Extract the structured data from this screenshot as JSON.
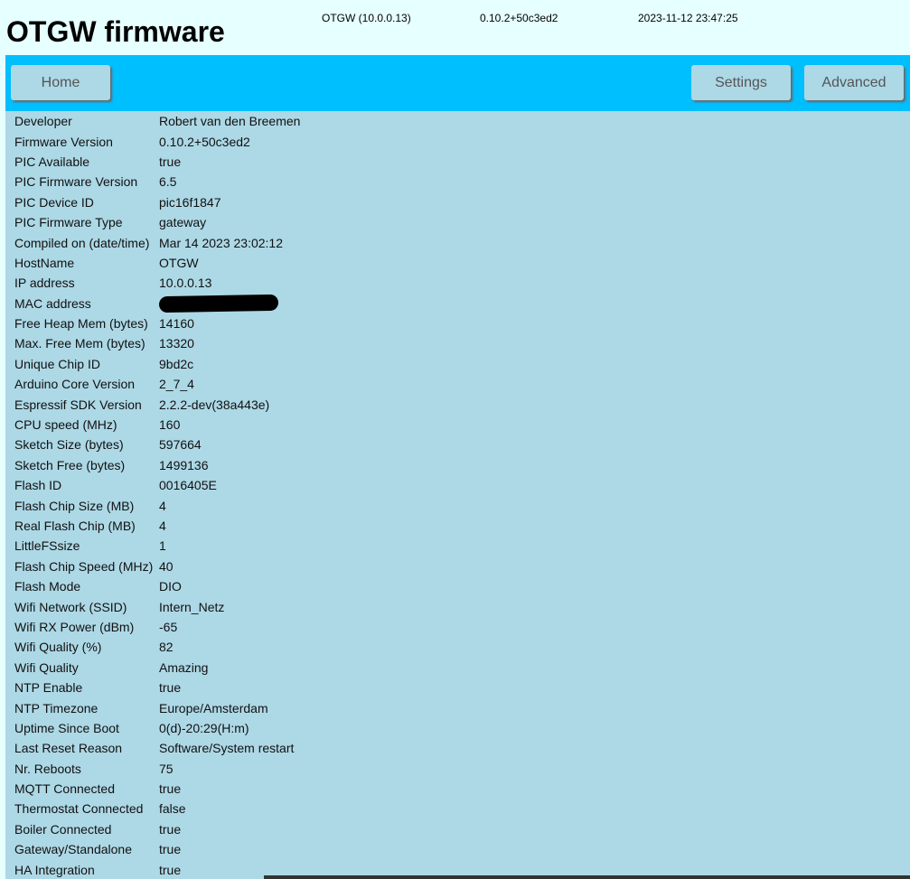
{
  "header": {
    "title": "OTGW firmware",
    "host_info": "OTGW (10.0.0.13)",
    "version": "0.10.2+50c3ed2",
    "datetime": "2023-11-12 23:47:25"
  },
  "nav": {
    "home": "Home",
    "settings": "Settings",
    "advanced": "Advanced"
  },
  "colors": {
    "header_bg": "#e6ffff",
    "navbar_bg": "#00bfff",
    "content_bg": "#add8e6",
    "button_bg": "#add8e6"
  },
  "info_rows": [
    {
      "label": "Developer",
      "value": "Robert van den Breemen"
    },
    {
      "label": "Firmware Version",
      "value": "0.10.2+50c3ed2"
    },
    {
      "label": "PIC Available",
      "value": "true"
    },
    {
      "label": "PIC Firmware Version",
      "value": "6.5"
    },
    {
      "label": "PIC Device ID",
      "value": "pic16f1847"
    },
    {
      "label": "PIC Firmware Type",
      "value": "gateway"
    },
    {
      "label": "Compiled on (date/time)",
      "value": "Mar 14 2023 23:02:12"
    },
    {
      "label": "HostName",
      "value": "OTGW"
    },
    {
      "label": "IP address",
      "value": "10.0.0.13"
    },
    {
      "label": "MAC address",
      "value": "",
      "redacted": true
    },
    {
      "label": "Free Heap Mem (bytes)",
      "value": "14160"
    },
    {
      "label": "Max. Free Mem (bytes)",
      "value": "13320"
    },
    {
      "label": "Unique Chip ID",
      "value": "9bd2c"
    },
    {
      "label": "Arduino Core Version",
      "value": "2_7_4"
    },
    {
      "label": "Espressif SDK Version",
      "value": "2.2.2-dev(38a443e)"
    },
    {
      "label": "CPU speed (MHz)",
      "value": "160"
    },
    {
      "label": "Sketch Size (bytes)",
      "value": "597664"
    },
    {
      "label": "Sketch Free (bytes)",
      "value": "1499136"
    },
    {
      "label": "Flash ID",
      "value": "0016405E"
    },
    {
      "label": "Flash Chip Size (MB)",
      "value": "4"
    },
    {
      "label": "Real Flash Chip (MB)",
      "value": "4"
    },
    {
      "label": "LittleFSsize",
      "value": "1"
    },
    {
      "label": "Flash Chip Speed (MHz)",
      "value": "40"
    },
    {
      "label": "Flash Mode",
      "value": "DIO"
    },
    {
      "label": "Wifi Network (SSID)",
      "value": "Intern_Netz"
    },
    {
      "label": "Wifi RX Power (dBm)",
      "value": "-65"
    },
    {
      "label": "Wifi Quality (%)",
      "value": "82"
    },
    {
      "label": "Wifi Quality",
      "value": "Amazing"
    },
    {
      "label": "NTP Enable",
      "value": "true"
    },
    {
      "label": "NTP Timezone",
      "value": "Europe/Amsterdam"
    },
    {
      "label": "Uptime Since Boot",
      "value": "0(d)-20:29(H:m)"
    },
    {
      "label": "Last Reset Reason",
      "value": "Software/System restart"
    },
    {
      "label": "Nr. Reboots",
      "value": "75"
    },
    {
      "label": "MQTT Connected",
      "value": "true"
    },
    {
      "label": "Thermostat Connected",
      "value": "false"
    },
    {
      "label": "Boiler Connected",
      "value": "true"
    },
    {
      "label": "Gateway/Standalone",
      "value": "true"
    },
    {
      "label": "HA Integration",
      "value": "true"
    }
  ]
}
